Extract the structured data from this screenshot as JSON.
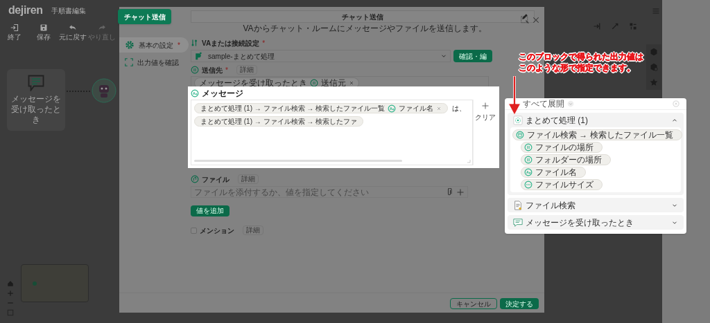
{
  "app": {
    "logo": "dejiren",
    "title": "手順書編集",
    "toolbar": [
      {
        "label": "終了",
        "disabled": false
      },
      {
        "label": "保存",
        "disabled": false
      },
      {
        "label": "元に戻す",
        "disabled": false
      },
      {
        "label": "やり直し",
        "disabled": true
      }
    ],
    "trigger_node": {
      "label": "メッセージを受け取ったとき"
    }
  },
  "modal": {
    "tab_label": "チャット送信",
    "title": "チャット送信",
    "description": "VAからチャット・ルームにメッセージやファイルを送信します。",
    "nav": [
      {
        "label": "基本の設定",
        "required_mark": "*",
        "selected": true
      },
      {
        "label": "出力値を確認",
        "selected": false
      }
    ],
    "va": {
      "label": "VAまたは接続設定",
      "required_mark": "*",
      "value": "sample-まとめて処理",
      "button": "確認・編"
    },
    "recipient": {
      "label": "送信先",
      "required_mark": "*",
      "detail": "詳細",
      "chips": [
        {
          "source": "メッセージを受け取ったとき",
          "kind": "path",
          "name": "送信元"
        }
      ]
    },
    "message": {
      "label": "メッセージ",
      "tokens": [
        {
          "kind": "chip",
          "path": "まとめて処理 (1) → ファイル検索 → 検索したファイル一覧",
          "variable": {
            "kind": "text",
            "name": "ファイル名"
          }
        },
        {
          "kind": "text",
          "text": "は、"
        },
        {
          "kind": "chip",
          "path": "まとめて処理 (1) → ファイル検索 → 検索したファ"
        }
      ],
      "clear": "クリア"
    },
    "file": {
      "label": "ファイル",
      "detail": "詳細",
      "placeholder": "ファイルを添付するか、値を指定してください",
      "add_button": "値を追加"
    },
    "mention": {
      "label": "メンション",
      "detail": "詳細",
      "checked": false
    },
    "footer": {
      "cancel": "キャンセル",
      "ok": "決定する"
    }
  },
  "picker": {
    "expand_all": "すべて展開",
    "groups": [
      {
        "title": "まとめて処理 (1)",
        "expanded": true,
        "items": [
          {
            "label": "ファイル検索 → 検索したファイル一覧",
            "kind": "list",
            "children": [
              {
                "label": "ファイルの場所",
                "kind": "path"
              },
              {
                "label": "フォルダーの場所",
                "kind": "path"
              },
              {
                "label": "ファイル名",
                "kind": "text"
              },
              {
                "label": "ファイルサイズ",
                "kind": "number"
              }
            ]
          }
        ]
      },
      {
        "title": "ファイル検索",
        "expanded": false
      },
      {
        "title": "メッセージを受け取ったとき",
        "expanded": false
      }
    ]
  },
  "annotation": {
    "lines": [
      "このブロックで得られた出力値は",
      "このような形で指定できます。"
    ]
  }
}
